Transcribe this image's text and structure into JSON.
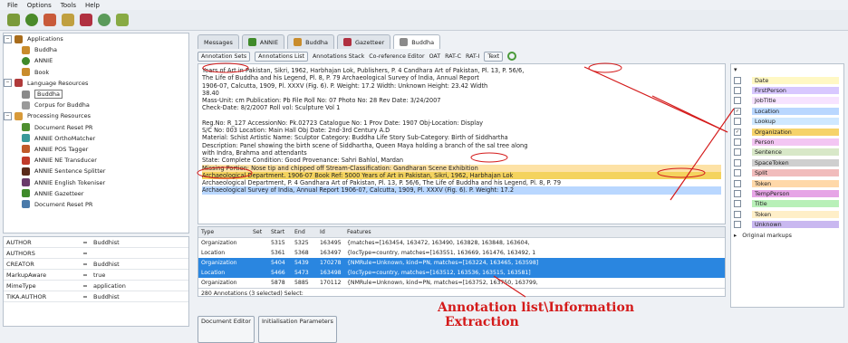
{
  "menu": [
    "File",
    "Options",
    "Tools",
    "Help"
  ],
  "toolbar": {
    "icons": [
      "open-icon",
      "save-icon",
      "plugin-icon",
      "config-icon",
      "record-icon",
      "tool-icon",
      "edit-icon"
    ]
  },
  "tree": {
    "applications": "Applications",
    "app_items": [
      "Buddha",
      "ANNIE",
      "Book"
    ],
    "language_resources": "Language Resources",
    "lr_items": [
      "Buddha",
      "Corpus for Buddha"
    ],
    "processing_resources": "Processing Resources",
    "pr_items": [
      "Document Reset PR",
      "ANNIE OrthoMatcher",
      "ANNIE POS Tagger",
      "ANNIE NE Transducer",
      "ANNIE Sentence Splitter",
      "ANNIE English Tokeniser",
      "ANNIE Gazetteer",
      "Document Reset PR"
    ]
  },
  "features": [
    {
      "key": "AUTHOR",
      "value": "Buddhist"
    },
    {
      "key": "AUTHORS",
      "value": ""
    },
    {
      "key": "CREATOR",
      "value": "Buddhist"
    },
    {
      "key": "MarkupAware",
      "value": "true"
    },
    {
      "key": "MimeType",
      "value": "application"
    },
    {
      "key": "TIKA.AUTHOR",
      "value": "Buddhist"
    }
  ],
  "tabs": [
    "Messages",
    "ANNIE",
    "Buddha",
    "Gazetteer",
    "Buddha"
  ],
  "subtoolbar": [
    "Annotation Sets",
    "Annotations List",
    "Annotations Stack",
    "Co-reference Editor",
    "OAT",
    "RAT-C",
    "RAT-I",
    "Text"
  ],
  "text_lines": [
    "Years of Art in Pakistan, Sikri, 1962, Harbhajan Lok, Publishers, P. 4 Candhara Art of Pakistan, Pl. 13, P. 56/6,",
    "The Life of Buddha and his Legend, Pl. 8, P. 79 Archaeological Survey of India, Annual Report",
    "1906-07, Calcutta, 1909, Pl. XXXV (Fig. 6). P. Weight: 17.2  Width: Unknown  Height: 23.42  Width",
    "38.40",
    "Mass-Unit: cm Publication: Pb File Roll No: 07                    Photo No: 28  Rev   Date: 3/24/2007",
    "Check-Date: 8/2/2007  Roll vol: Sculpture Vol 1",
    "",
    "Reg.No: R_127  AccessionNo: Pk.02723   Catalogue No: 1  Prov Date: 1907  Obj-Location:  Display",
    "S/C No: 003   Location: Main Hall Obj Date: 2nd-3rd Century A.D",
    "Material: Schist  Artistic Name: Sculptor Category: Buddha Life Story  Sub-Category: Birth of Siddhartha",
    "Description: Panel showing the birth scene of Siddhartha, Queen Maya holding a branch of the sal tree along",
    "with Indra, Brahma and attendants",
    "State: Complete  Condition: Good  Provenance: Sahri Bahlol, Mardan",
    "Missing Portion: Nose tip and chipped off               Stream-Classification: Gandharan Scene Exhibition",
    "Archaeological Department. 1906-07   Book Ref: 5000 Years of Art in Pakistan, Sikri, 1962, Harbhajan Lok",
    "Archaeological Department, P. 4 Gandhara Art of Pakistan, Pl. 13, P. 56/6, The Life of Buddha and his Legend, Pl. 8, P. 79",
    "Archaeological Survey of India, Annual Report 1906-07, Calcutta, 1909, Pl. XXXV (Fig. 6). P. Weight: 17.2"
  ],
  "annotations": {
    "headers": [
      "Type",
      "Set",
      "Start",
      "End",
      "Id",
      "Features"
    ],
    "rows": [
      {
        "type": "Organization",
        "set": "",
        "start": "5315",
        "end": "5325",
        "id": "163495",
        "features": "{matches=[163454, 163472, 163490, 163828, 163848, 163604,"
      },
      {
        "type": "Location",
        "set": "",
        "start": "5361",
        "end": "5368",
        "id": "163497",
        "features": "{locType=country, matches=[163551, 163669, 161476, 163492, 1"
      },
      {
        "type": "Organization",
        "set": "",
        "start": "5404",
        "end": "5439",
        "id": "170278",
        "features": "{NMRule=Unknown, kind=PN, matches=[163224, 163465, 163598]"
      },
      {
        "type": "Location",
        "set": "",
        "start": "5466",
        "end": "5473",
        "id": "163498",
        "features": "{locType=country, matches=[163512, 163536, 163515, 163581]"
      },
      {
        "type": "Organization",
        "set": "",
        "start": "5878",
        "end": "5885",
        "id": "170112",
        "features": "{NMRule=Unknown, kind=PN, matches=[163752, 163750, 163799,"
      }
    ],
    "status": "280 Annotations (3 selected)   Select:",
    "bottom_tabs": [
      "Document Editor",
      "Initialisation Parameters"
    ]
  },
  "annotation_types": [
    {
      "label": "Date",
      "color": "#fff8c4"
    },
    {
      "label": "FirstPerson",
      "color": "#d8c8ff"
    },
    {
      "label": "JobTitle",
      "color": "#f7e3ff"
    },
    {
      "label": "Location",
      "color": "#b9d7ff",
      "checked": true
    },
    {
      "label": "Lookup",
      "color": "#cfe8ff"
    },
    {
      "label": "Organization",
      "color": "#f6d36a",
      "checked": true
    },
    {
      "label": "Person",
      "color": "#f3c6f3"
    },
    {
      "label": "Sentence",
      "color": "#d8e8c8"
    },
    {
      "label": "SpaceToken",
      "color": "#cfcfcf"
    },
    {
      "label": "Split",
      "color": "#f1bcbc"
    },
    {
      "label": "Token",
      "color": "#ffd8a8"
    },
    {
      "label": "TempPerson",
      "color": "#e6a4e6"
    },
    {
      "label": "Title",
      "color": "#b8f0b8"
    },
    {
      "label": "Token",
      "color": "#ffefc8"
    },
    {
      "label": "Unknown",
      "color": "#c9b8f0"
    }
  ],
  "original_markups": "Original markups",
  "caption": [
    "Annotation list\\Information",
    "Extraction"
  ],
  "colors": {
    "accent_red": "#d41a1a",
    "selection": "#2a86e0"
  }
}
